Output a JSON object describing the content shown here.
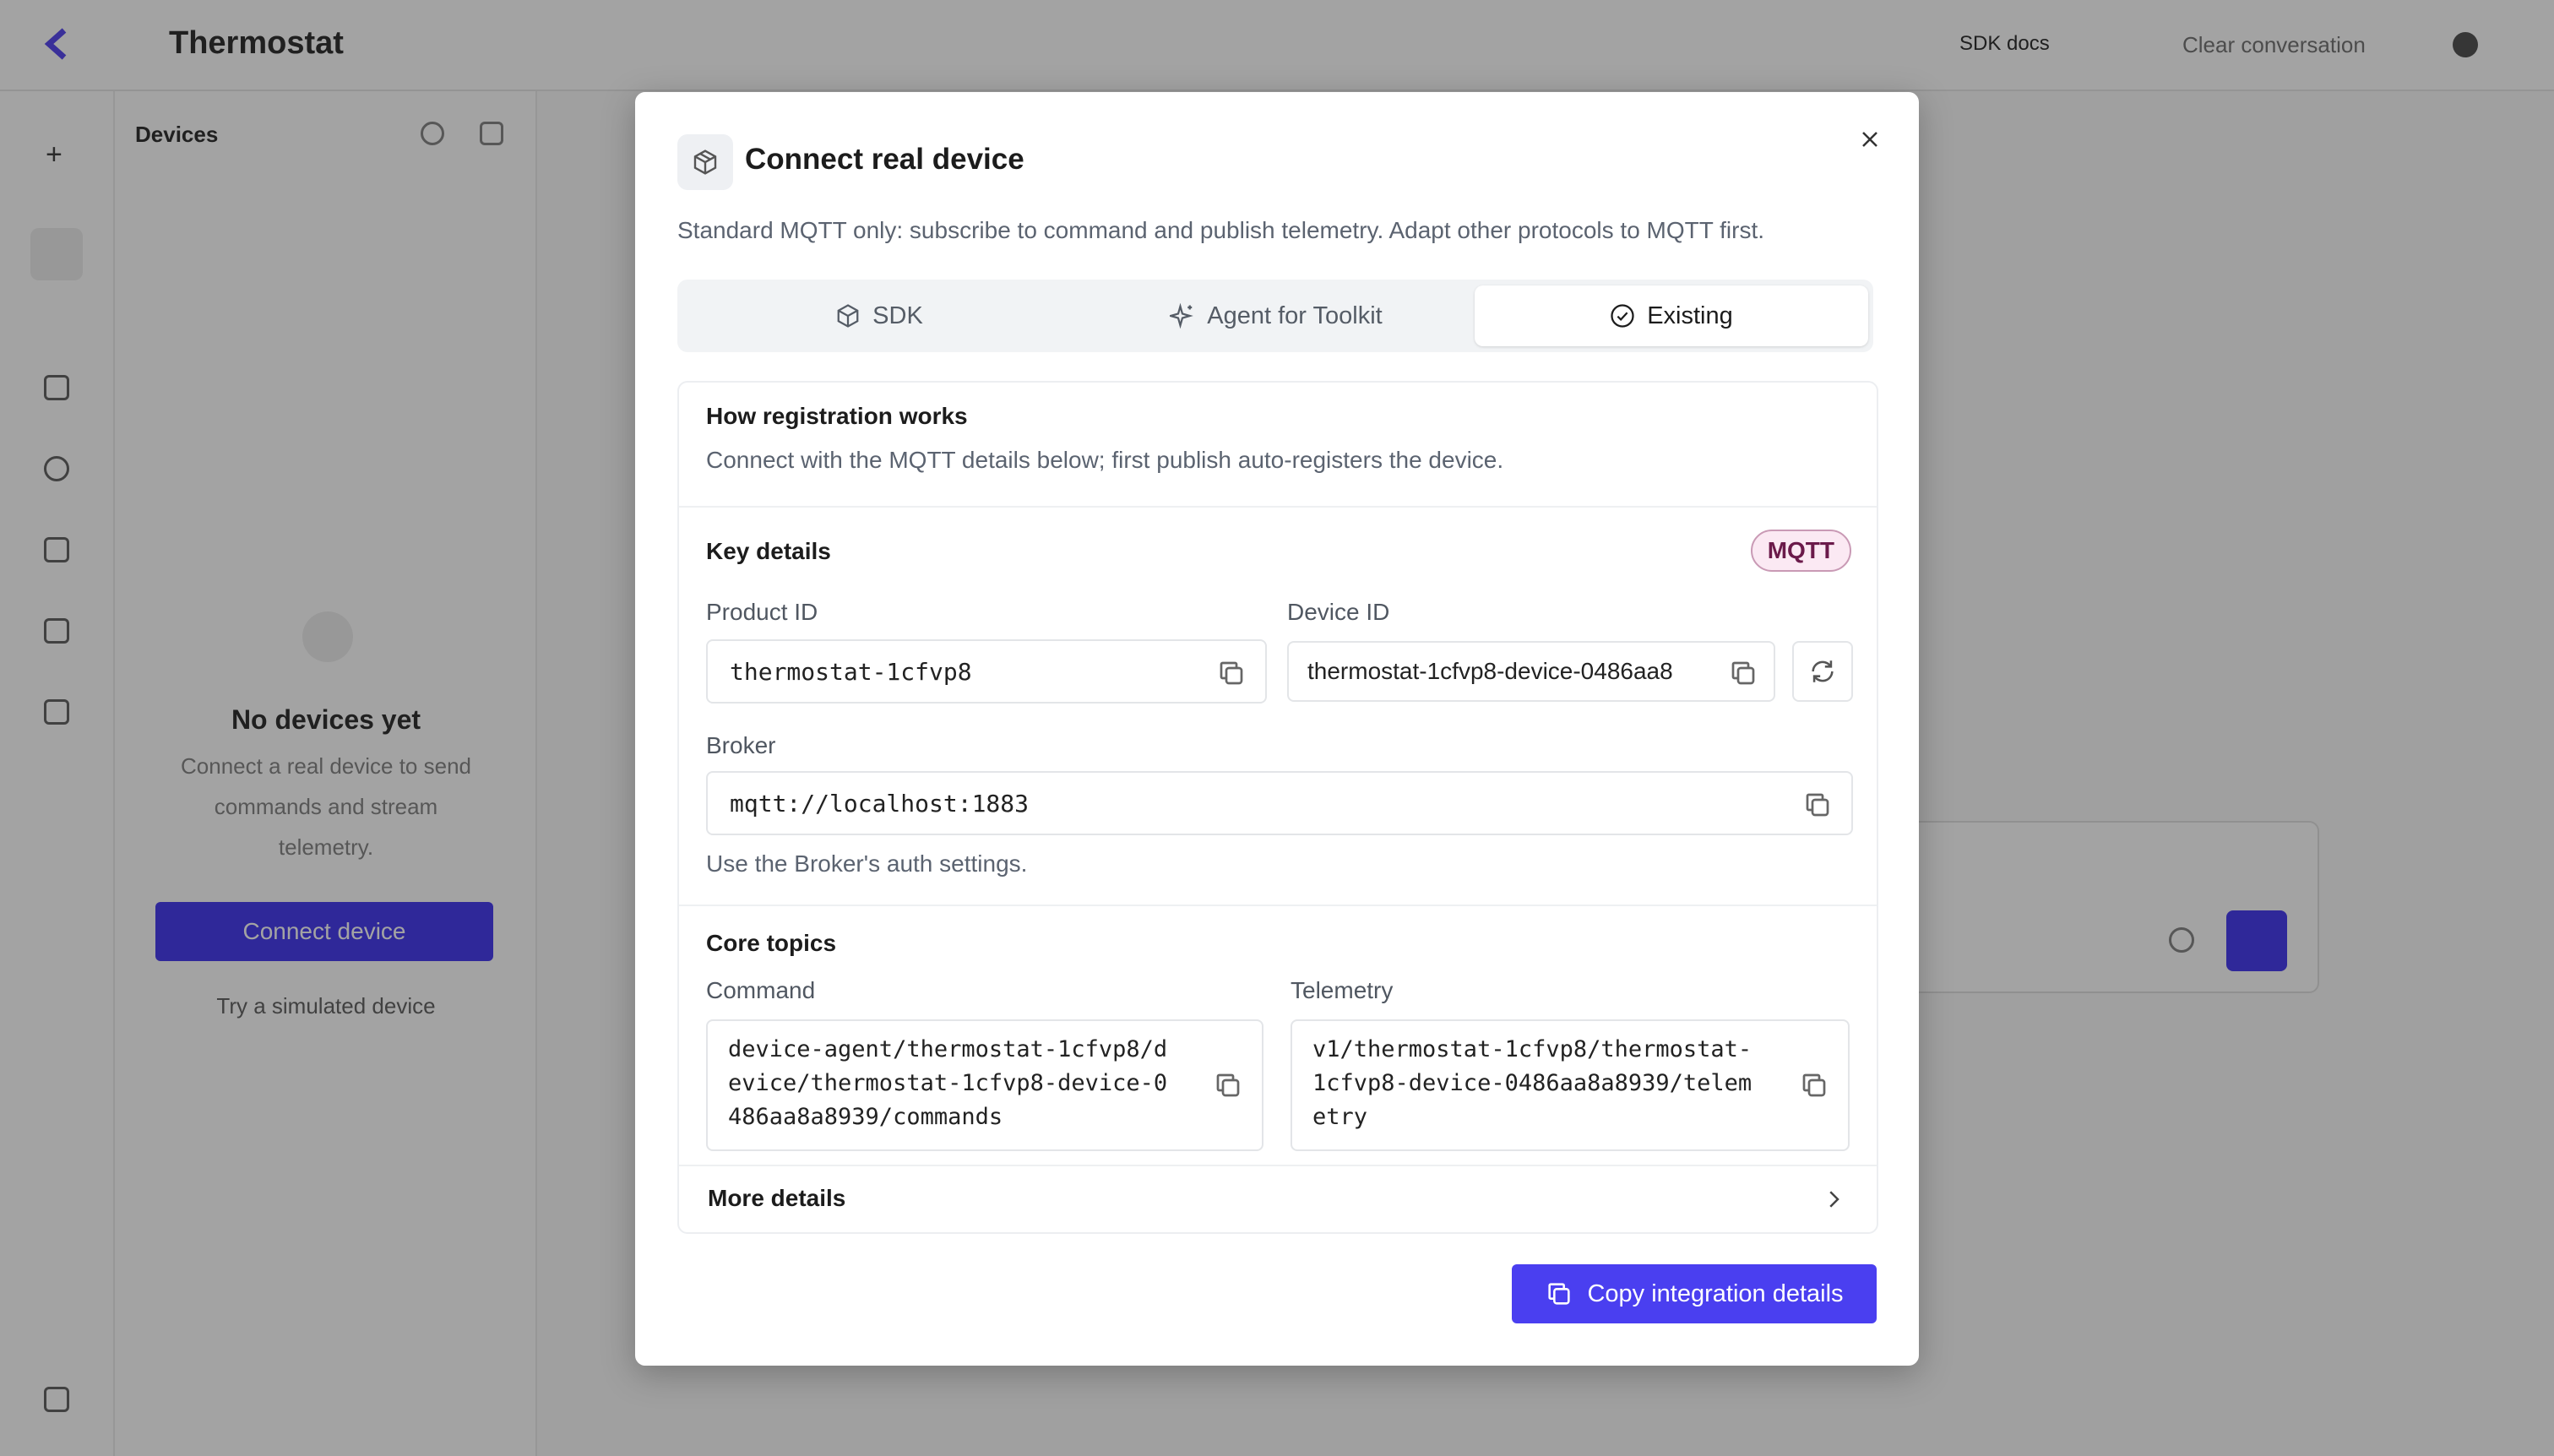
{
  "background": {
    "app_title": "Thermostat",
    "top_right_link": "SDK docs",
    "top_right_action": "Clear conversation",
    "sidebar_header": "Devices",
    "empty_title": "No devices yet",
    "empty_desc_lines": [
      "Connect a real device to send",
      "commands and stream",
      "telemetry."
    ],
    "connect_button": "Connect device",
    "simulated_link": "Try a simulated device"
  },
  "modal": {
    "title": "Connect real device",
    "description": "Standard MQTT only: subscribe to command and publish telemetry. Adapt other protocols to MQTT first.",
    "tabs": [
      {
        "label": "SDK",
        "icon": "package-icon",
        "active": false
      },
      {
        "label": "Agent for Toolkit",
        "icon": "sparkle-icon",
        "active": false
      },
      {
        "label": "Existing",
        "icon": "check-circle-icon",
        "active": true
      }
    ],
    "registration": {
      "title": "How registration works",
      "text": "Connect with the MQTT details below; first publish auto-registers the device."
    },
    "key_details": {
      "title": "Key details",
      "badge": "MQTT",
      "product_id_label": "Product ID",
      "product_id": "thermostat-1cfvp8",
      "device_id_label": "Device ID",
      "device_id": "thermostat-1cfvp8-device-0486aa8",
      "broker_label": "Broker",
      "broker": "mqtt://localhost:1883",
      "broker_note": "Use the Broker's auth settings."
    },
    "core_topics": {
      "title": "Core topics",
      "command_label": "Command",
      "command": "device-agent/thermostat-1cfvp8/d\nevice/thermostat-1cfvp8-device-0\n486aa8a8939/commands",
      "telemetry_label": "Telemetry",
      "telemetry": "v1/thermostat-1cfvp8/thermostat-\n1cfvp8-device-0486aa8a8939/telem\netry"
    },
    "more_details": "More details",
    "copy_button": "Copy integration details"
  },
  "colors": {
    "primary": "#4a3ff0",
    "badge_bg": "#fbe9f3",
    "badge_text": "#6b1a4a",
    "overlay": "rgba(0,0,0,0.36)"
  }
}
